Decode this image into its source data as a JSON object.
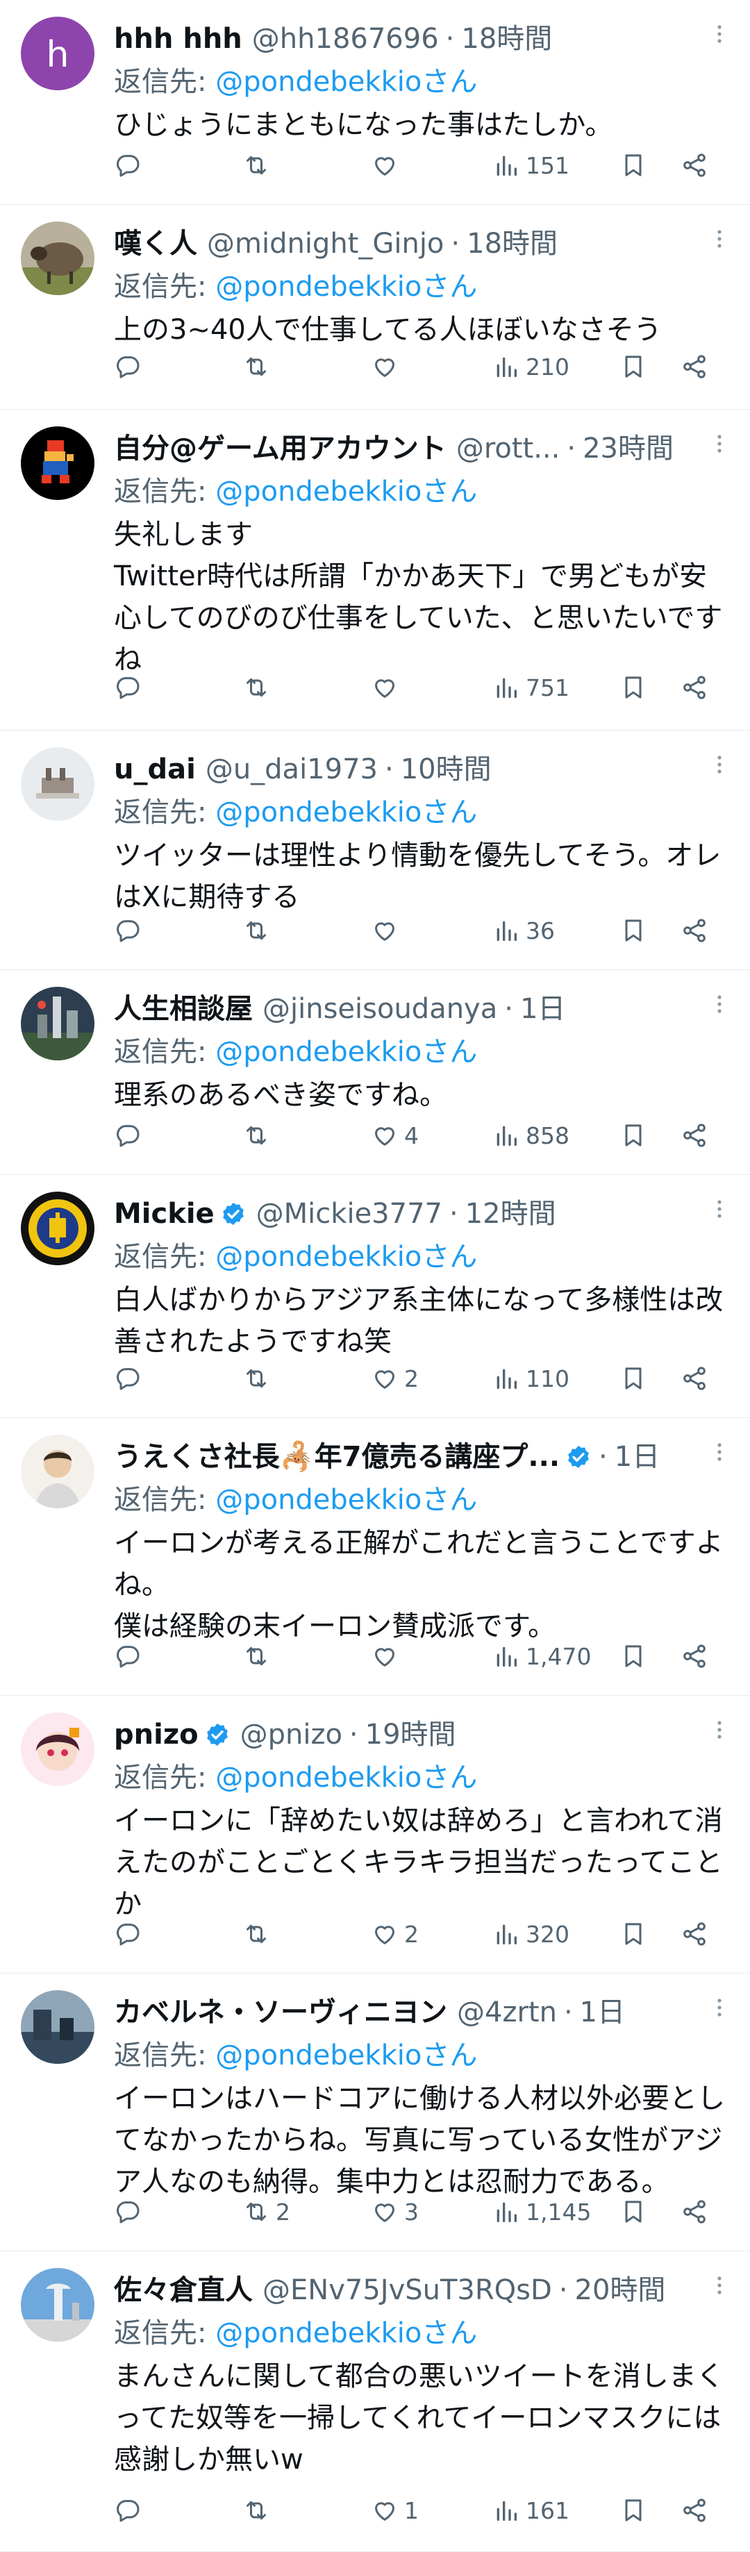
{
  "reply_prefix": "返信先: ",
  "separator": "·",
  "replies": [
    {
      "name": "hhh hhh",
      "handle": "@hh1867696",
      "time": "18時間",
      "reply_to": "@pondebekkioさん",
      "text": "ひじょうにまともになった事はたしか。",
      "replies": "",
      "retweets": "",
      "likes": "",
      "views": "151",
      "verified": false,
      "avatar_letter": "h"
    },
    {
      "name": "嘆く人",
      "handle": "@midnight_Ginjo",
      "time": "18時間",
      "reply_to": "@pondebekkioさん",
      "text": "上の3~40人で仕事してる人ほぼいなさそう",
      "replies": "",
      "retweets": "",
      "likes": "",
      "views": "210",
      "verified": false
    },
    {
      "name": "自分@ゲーム用アカウント",
      "handle": "@rott...",
      "time": "23時間",
      "reply_to": "@pondebekkioさん",
      "text": "失礼します\nTwitter時代は所謂「かかあ天下」で男どもが安心してのびのび仕事をしていた、と思いたいですね",
      "replies": "",
      "retweets": "",
      "likes": "",
      "views": "751",
      "verified": false
    },
    {
      "name": "u_dai",
      "handle": "@u_dai1973",
      "time": "10時間",
      "reply_to": "@pondebekkioさん",
      "text": "ツイッターは理性より情動を優先してそう。オレはXに期待する",
      "replies": "",
      "retweets": "",
      "likes": "",
      "views": "36",
      "verified": false
    },
    {
      "name": "人生相談屋",
      "handle": "@jinseisoudanya",
      "time": "1日",
      "reply_to": "@pondebekkioさん",
      "text": "理系のあるべき姿ですね。",
      "replies": "",
      "retweets": "",
      "likes": "4",
      "views": "858",
      "verified": false
    },
    {
      "name": "Mickie",
      "handle": "@Mickie3777",
      "time": "12時間",
      "reply_to": "@pondebekkioさん",
      "text": "白人ばかりからアジア系主体になって多様性は改善されたようですね笑",
      "replies": "",
      "retweets": "",
      "likes": "2",
      "views": "110",
      "verified": true
    },
    {
      "name": "うえくさ社長🦂年7億売る講座プ...",
      "handle": "",
      "time": "1日",
      "reply_to": "@pondebekkioさん",
      "text": "イーロンが考える正解がこれだと言うことですよね。\n僕は経験の末イーロン賛成派です。",
      "replies": "",
      "retweets": "",
      "likes": "",
      "views": "1,470",
      "verified": true
    },
    {
      "name": "pnizo",
      "handle": "@pnizo",
      "time": "19時間",
      "reply_to": "@pondebekkioさん",
      "text": "イーロンに「辞めたい奴は辞めろ」と言われて消えたのがことごとくキラキラ担当だったってことか",
      "replies": "",
      "retweets": "",
      "likes": "2",
      "views": "320",
      "verified": true
    },
    {
      "name": "カベルネ・ソーヴィニヨン",
      "handle": "@4zrtn",
      "time": "1日",
      "reply_to": "@pondebekkioさん",
      "text": "イーロンはハードコアに働ける人材以外必要としてなかったからね。写真に写っている女性がアジア人なのも納得。集中力とは忍耐力である。",
      "replies": "",
      "retweets": "2",
      "likes": "3",
      "views": "1,145",
      "verified": false
    },
    {
      "name": "佐々倉直人",
      "handle": "@ENv75JvSuT3RQsD",
      "time": "20時間",
      "reply_to": "@pondebekkioさん",
      "text": "まんさんに関して都合の悪いツイートを消しまくってた奴等を一掃してくれてイーロンマスクには感謝しか無いw",
      "replies": "",
      "retweets": "",
      "likes": "1",
      "views": "161",
      "verified": false
    }
  ]
}
